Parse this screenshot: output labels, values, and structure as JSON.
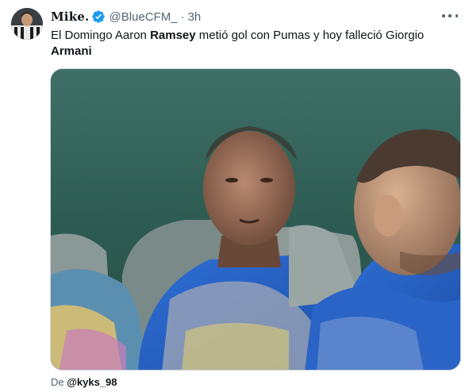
{
  "author": {
    "name": "Mike.",
    "handle": "@BlueCFM_",
    "separator": "·",
    "time": "3h"
  },
  "tweet": {
    "part1": "El Domingo Aaron ",
    "bold1": "Ramsey",
    "part2": " metió gol con Pumas y hoy falleció Giorgio ",
    "bold2": "Armani"
  },
  "footer": {
    "prefix": "De ",
    "via_handle": "@kyks_98"
  },
  "colors": {
    "verified": "#1d9bf0",
    "secondary_text": "#536471"
  },
  "icons": {
    "verified": "verified-badge-icon",
    "more": "more-options-icon"
  }
}
